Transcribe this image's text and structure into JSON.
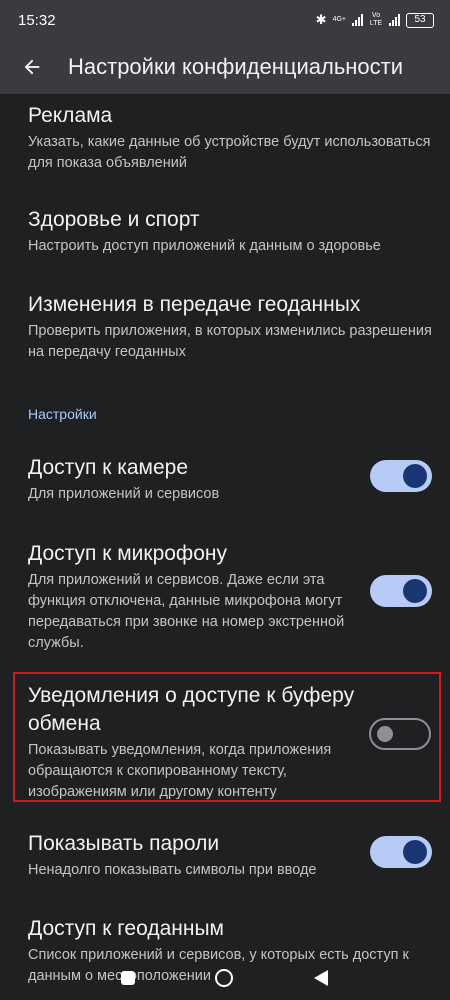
{
  "status_bar": {
    "time": "15:32",
    "network": "4G+",
    "lte_badge": "Vo LTE",
    "battery": "53"
  },
  "app_bar": {
    "title": "Настройки конфиденциальности",
    "back_icon": "arrow-back-icon"
  },
  "items": [
    {
      "title": "Реклама",
      "subtitle": "Указать, какие данные об устройстве будут использоваться для показа объявлений"
    },
    {
      "title": "Здоровье и спорт",
      "subtitle": "Настроить доступ приложений к данным о здоровье"
    },
    {
      "title": "Изменения в передаче геоданных",
      "subtitle": "Проверить приложения, в которых изменились разрешения на передачу геоданных"
    }
  ],
  "section": {
    "label": "Настройки"
  },
  "settings": [
    {
      "title": "Доступ к камере",
      "subtitle": "Для приложений и сервисов",
      "enabled": true
    },
    {
      "title": "Доступ к микрофону",
      "subtitle": "Для приложений и сервисов. Даже если эта функция отключена, данные микрофона могут передаваться при звонке на номер экстренной службы.",
      "enabled": true
    },
    {
      "title": "Уведомления о доступе к буферу обмена",
      "subtitle": "Показывать уведомления, когда приложения обращаются к скопированному тексту, изображениям или другому контенту",
      "enabled": false
    },
    {
      "title": "Показывать пароли",
      "subtitle": "Ненадолго показывать символы при вводе",
      "enabled": true
    },
    {
      "title": "Доступ к геоданным",
      "subtitle": "Список приложений и сервисов, у которых есть доступ к данным о местоположении"
    }
  ],
  "colors": {
    "background": "#1f2022",
    "app_bar": "#3a3b3e",
    "accent": "#a9c7ff",
    "toggle_on_track": "#b7cbf6",
    "toggle_on_thumb": "#1a3672",
    "highlight": "#d21a1a"
  }
}
